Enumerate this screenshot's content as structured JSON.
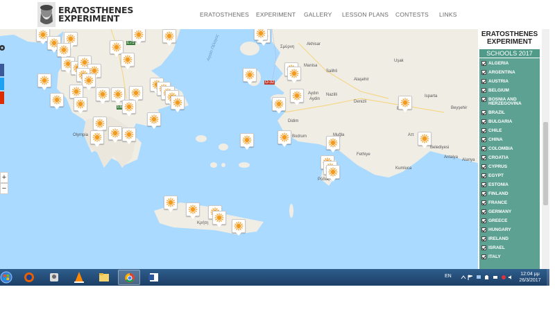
{
  "header": {
    "logo_line1": "ERATOSTHENES",
    "logo_line2": "EXPERIMENT",
    "nav": [
      "ERATOSTHENES",
      "EXPERIMENT",
      "GALLERY",
      "LESSON PLANS",
      "CONTESTS",
      "LINKS"
    ]
  },
  "map": {
    "labels": [
      "Σμύρνη",
      "Akhisar",
      "Manisa",
      "Uşak",
      "Salihli",
      "Alaşehir",
      "Aydın",
      "Nazilli",
      "Denizli",
      "Aydin",
      "Bodrum",
      "Didim",
      "Muğla",
      "Fethiye",
      "Antalya",
      "Kumluca",
      "Alanya",
      "Beyşehir",
      "Burdur",
      "Isparta",
      "Κρήτη",
      "Ρόδος",
      "Αττ",
      "Belediyesi",
      "Olympia",
      "E75",
      "E65"
    ],
    "sea_labels": [
      "Αιγαίο Πέλαγος"
    ],
    "road_labels": [
      "O-32",
      "D300",
      "D400"
    ],
    "zoom_in": "+",
    "zoom_out": "−"
  },
  "panel": {
    "title_line1": "ERATOSTHENES",
    "title_line2": "EXPERIMENT",
    "year": "SCHOOLS 2017",
    "countries": [
      "ALGERIA",
      "ARGENTINA",
      "AUSTRIA",
      "BELGIUM",
      "BOSNIA AND",
      "HERZEGOVINA",
      "BRAZIL",
      "BULGARIA",
      "CHILE",
      "CHINA",
      "COLOMBIA",
      "CROATIA",
      "CYPRUS",
      "EGYPT",
      "ESTONIA",
      "FINLAND",
      "FRANCE",
      "GERMANY",
      "GREECE",
      "HUNGARY",
      "IRELAND",
      "ISRAEL",
      "ITALY"
    ]
  },
  "taskbar": {
    "lang": "EN",
    "time": "12:04 μμ",
    "date": "26/3/2017",
    "apps": [
      "firefox-icon",
      "user-accounts-icon",
      "vlc-icon",
      "file-explorer-icon",
      "chrome-icon",
      "word-icon"
    ]
  },
  "colors": {
    "sea": "#aadaff",
    "land": "#f0ede5",
    "panel_green": "#5ca192",
    "marker_sun": "#f29a1d",
    "taskbar": "#23476f"
  }
}
